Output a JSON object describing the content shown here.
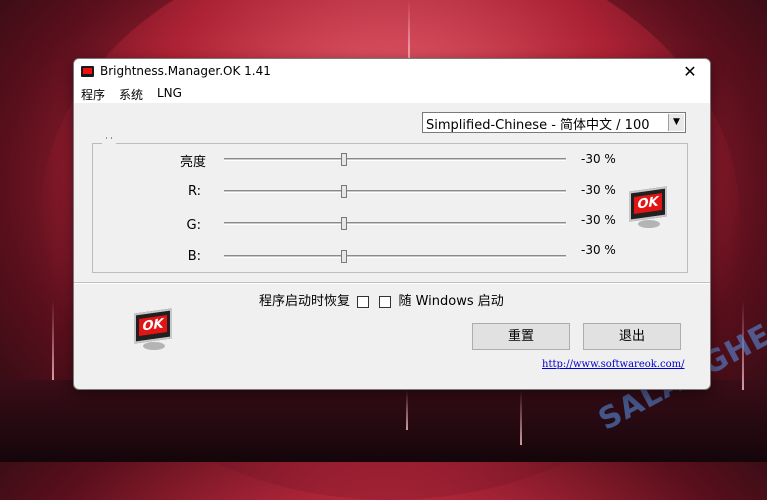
{
  "window": {
    "title": "Brightness.Manager.OK 1.41",
    "close_glyph": "✕",
    "app_icon": "monitor-icon"
  },
  "menu": [
    "程序",
    "系统",
    "LNG"
  ],
  "language": {
    "selected": "Simplified-Chinese - 简体中文 / 100",
    "arrow": "▼"
  },
  "group_mark": "˙˙",
  "sliders": [
    {
      "label": "亮度",
      "value": -30,
      "value_text": "-30 %"
    },
    {
      "label": "R:",
      "value": -30,
      "value_text": "-30 %"
    },
    {
      "label": "G:",
      "value": -30,
      "value_text": "-30 %"
    },
    {
      "label": "B:",
      "value": -30,
      "value_text": "-30 %"
    }
  ],
  "slider_range": [
    -100,
    100
  ],
  "logo_text": "OK",
  "options": {
    "restore_label": "程序启动时恢复",
    "restore_checked": false,
    "autostart_label": "随 Windows 启动",
    "autostart_checked": false
  },
  "buttons": {
    "reset": "重置",
    "exit": "退出"
  },
  "link": "http://www.softwareok.com/",
  "watermark": "SALANGHE",
  "colors": {
    "accent_red": "#e31414",
    "link_blue": "#0000cc"
  }
}
